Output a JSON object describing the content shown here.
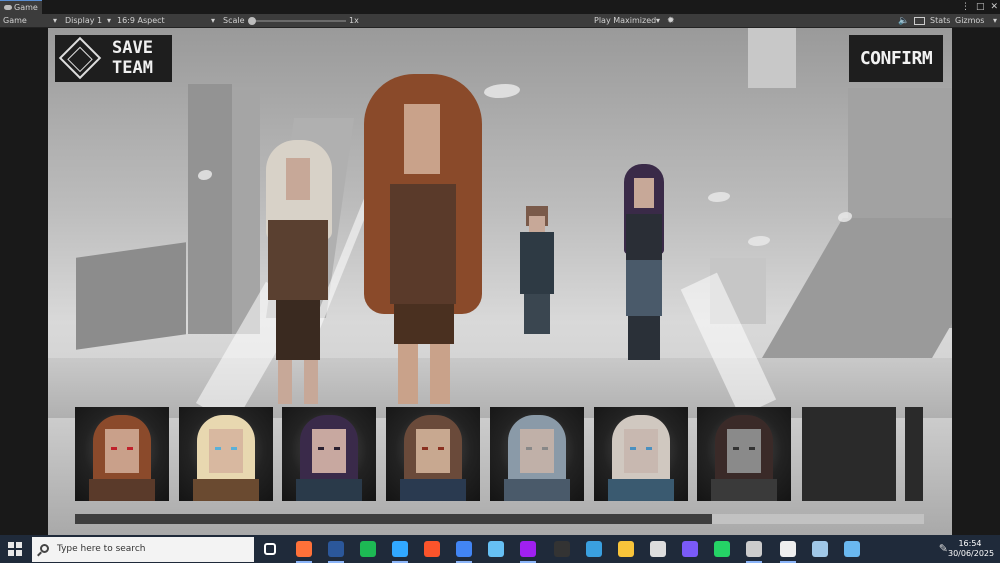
{
  "editor": {
    "tab_title": "Game",
    "tab_tools": [
      "⋮",
      "□",
      "✕"
    ],
    "toolbar": {
      "view_mode": "Game",
      "display": "Display 1",
      "aspect": "16:9 Aspect",
      "scale_label": "Scale",
      "scale_value": "1x",
      "play_mode": "Play Maximized",
      "stats_label": "Stats",
      "gizmos_label": "Gizmos"
    }
  },
  "game": {
    "logo_line1": "SAVE",
    "logo_line2": "TEAM",
    "confirm_label": "CONFIRM",
    "scroll_position": 0.75,
    "portraits": [
      {
        "name": "redhead",
        "hair": "#8b4a2b",
        "skin": "#c9a08a",
        "eye": "#c0202a",
        "body": "#5a3a2a"
      },
      {
        "name": "blonde",
        "hair": "#e8d8b0",
        "skin": "#d8b8a0",
        "eye": "#5ab0d8",
        "body": "#6a4a30"
      },
      {
        "name": "purple-hair",
        "hair": "#3a2a4a",
        "skin": "#c8a8a0",
        "eye": "#2a2030",
        "body": "#2a3a4a"
      },
      {
        "name": "brown-hair",
        "hair": "#6a4a3a",
        "skin": "#c8a890",
        "eye": "#8a3020",
        "body": "#2a3a50"
      },
      {
        "name": "hooded",
        "hair": "#8a9aa8",
        "skin": "#c0b0a8",
        "eye": "#888888",
        "body": "#4a5a6a"
      },
      {
        "name": "masked",
        "hair": "#d0c8c0",
        "skin": "#c8b8b0",
        "eye": "#4a90c0",
        "body": "#3a5a70"
      },
      {
        "name": "dark-figure",
        "hair": "#3a2a28",
        "skin": "#8a8a8a",
        "eye": "#333333",
        "body": "#3a3a3a"
      }
    ]
  },
  "taskbar": {
    "search_placeholder": "Type here to search",
    "time": "16:54",
    "date": "30/06/2025",
    "apps": [
      {
        "name": "task-view-icon",
        "color": "#ffffff"
      },
      {
        "name": "firefox-icon",
        "color": "#ff7139"
      },
      {
        "name": "word-icon",
        "color": "#2b579a"
      },
      {
        "name": "spotify-icon",
        "color": "#1db954"
      },
      {
        "name": "photoshop-icon",
        "color": "#31a8ff"
      },
      {
        "name": "brave-icon",
        "color": "#fb542b"
      },
      {
        "name": "chrome-icon",
        "color": "#4285f4"
      },
      {
        "name": "steam-icon",
        "color": "#66c0f4"
      },
      {
        "name": "opera-icon",
        "color": "#a020f0"
      },
      {
        "name": "epic-games-icon",
        "color": "#333333"
      },
      {
        "name": "copilot-icon",
        "color": "#3aa0e0"
      },
      {
        "name": "file-explorer-icon",
        "color": "#f8c43a"
      },
      {
        "name": "github-desktop-icon",
        "color": "#dddddd"
      },
      {
        "name": "gamepad-icon",
        "color": "#7a5af8"
      },
      {
        "name": "whatsapp-icon",
        "color": "#25d366"
      },
      {
        "name": "unity-hub-icon",
        "color": "#cccccc"
      },
      {
        "name": "unity-editor-icon",
        "color": "#eeeeee"
      },
      {
        "name": "notes-icon",
        "color": "#a0c8e8"
      },
      {
        "name": "paint-icon",
        "color": "#6ab8f0"
      }
    ]
  }
}
